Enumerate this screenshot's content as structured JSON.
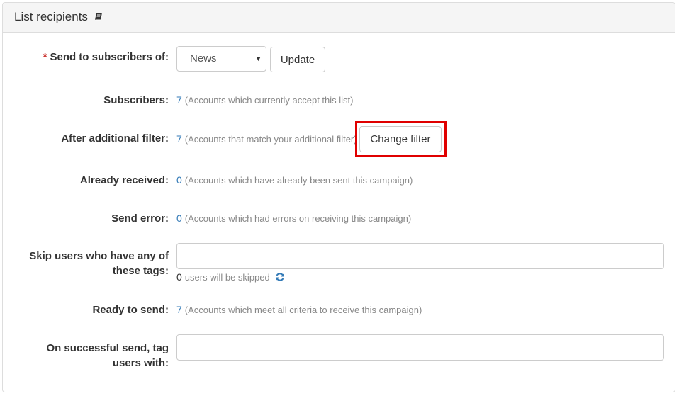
{
  "panel": {
    "title": "List recipients"
  },
  "form": {
    "send_to": {
      "required_mark": "*",
      "label": "Send to subscribers of:",
      "selected": "News",
      "update_label": "Update"
    },
    "subscribers": {
      "label": "Subscribers:",
      "count": "7",
      "help": "(Accounts which currently accept this list)"
    },
    "after_filter": {
      "label": "After additional filter:",
      "count": "7",
      "help": "(Accounts that match your additional filter)",
      "button_label": "Change filter"
    },
    "already_received": {
      "label": "Already received:",
      "count": "0",
      "help": "(Accounts which have already been sent this campaign)"
    },
    "send_error": {
      "label": "Send error:",
      "count": "0",
      "help": "(Accounts which had errors on receiving this campaign)"
    },
    "skip_tags": {
      "label_line1": "Skip users who have any of",
      "label_line2": "these tags:",
      "value": "",
      "skip_count": "0",
      "skip_text": "users will be skipped"
    },
    "ready": {
      "label": "Ready to send:",
      "count": "7",
      "help": "(Accounts which meet all criteria to receive this campaign)"
    },
    "tag_on_success": {
      "label_line1": "On successful send, tag",
      "label_line2": "users with:",
      "value": ""
    }
  },
  "colors": {
    "accent": "#337ab7",
    "required": "#c9302c",
    "highlight": "#e00000"
  }
}
